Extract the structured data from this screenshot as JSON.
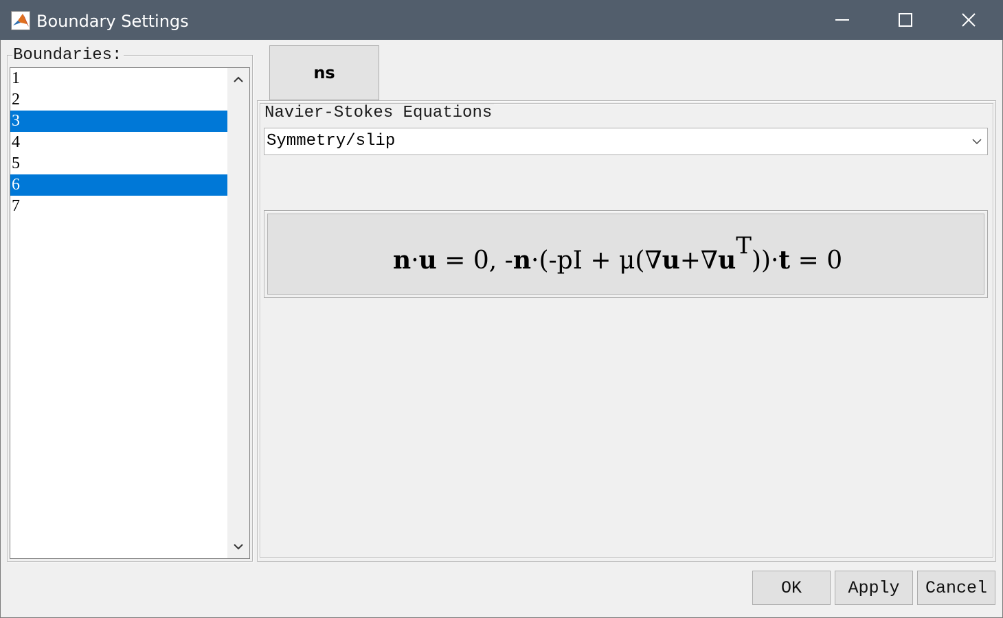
{
  "window": {
    "title": "Boundary Settings",
    "icon": "matlab-icon",
    "controls": [
      "minimize-icon",
      "maximize-icon",
      "close-icon"
    ]
  },
  "boundaries": {
    "label": "Boundaries:",
    "items": [
      {
        "label": "1",
        "selected": false
      },
      {
        "label": "2",
        "selected": false
      },
      {
        "label": "3",
        "selected": true
      },
      {
        "label": "4",
        "selected": false
      },
      {
        "label": "5",
        "selected": false
      },
      {
        "label": "6",
        "selected": true
      },
      {
        "label": "7",
        "selected": false
      }
    ]
  },
  "tabs": {
    "active": "ns"
  },
  "equations": {
    "group_label": "Navier-Stokes Equations",
    "boundary_condition": "Symmetry/slip",
    "formula": "n·u = 0, -n·(-pI + μ(∇u+∇u^T))·t = 0"
  },
  "buttons": {
    "ok": "OK",
    "apply": "Apply",
    "cancel": "Cancel"
  },
  "colors": {
    "titlebar": "#525e6c",
    "selection": "#0078d7",
    "background": "#f0f0f0"
  }
}
